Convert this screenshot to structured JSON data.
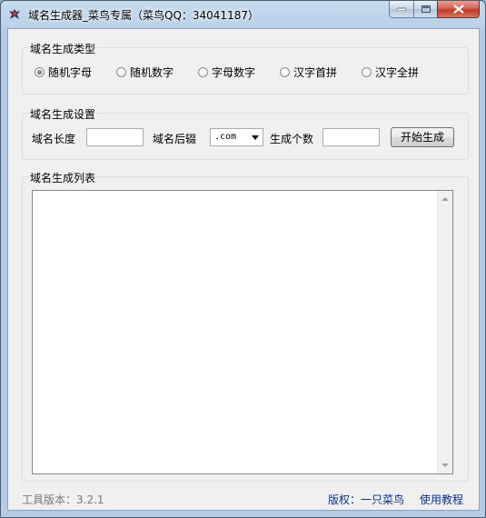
{
  "window": {
    "title": "域名生成器_菜鸟专属（菜鸟QQ：34041187）"
  },
  "type_group": {
    "label": "域名生成类型",
    "options": [
      {
        "label": "随机字母",
        "selected": true
      },
      {
        "label": "随机数字",
        "selected": false
      },
      {
        "label": "字母数字",
        "selected": false
      },
      {
        "label": "汉字首拼",
        "selected": false
      },
      {
        "label": "汉字全拼",
        "selected": false
      }
    ]
  },
  "settings_group": {
    "label": "域名生成设置",
    "length_label": "域名长度",
    "length_value": "",
    "suffix_label": "域名后辍",
    "suffix_value": ".com",
    "count_label": "生成个数",
    "count_value": "",
    "generate_button": "开始生成"
  },
  "list_group": {
    "label": "域名生成列表",
    "items": []
  },
  "footer": {
    "version": "工具版本：3.2.1",
    "copyright": "版权：一只菜鸟",
    "tutorial": "使用教程"
  }
}
